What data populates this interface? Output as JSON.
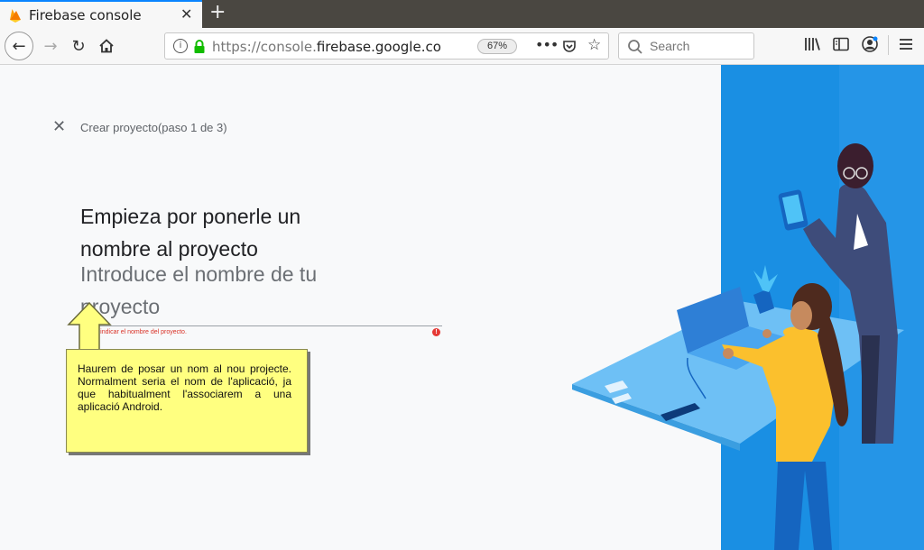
{
  "browser": {
    "tab_title": "Firebase console",
    "tab_close": "✕",
    "new_tab": "+",
    "url_prefix": "https://console.",
    "url_host": "firebase.google.com",
    "url_rest": "/",
    "zoom": "67%",
    "search_placeholder": "Search"
  },
  "page": {
    "close_symbol": "✕",
    "step_label": "Crear proyecto(paso 1 de 3)",
    "heading": "Empieza por ponerle un nombre al proyecto",
    "name_placeholder": "Introduce el nombre de tu proyecto",
    "error_message": "Debes indicar el nombre del proyecto.",
    "error_icon": "!"
  },
  "annotation": {
    "text": "Haurem de posar un nom al nou projecte. Normalment seria el nom de l'aplicació, ja que habitualment l'associarem a una aplicació Android."
  },
  "colors": {
    "accent": "#0a84ff",
    "illustration_blue": "#1a8fe3",
    "error": "#d93025",
    "callout_bg": "#ffff80"
  }
}
